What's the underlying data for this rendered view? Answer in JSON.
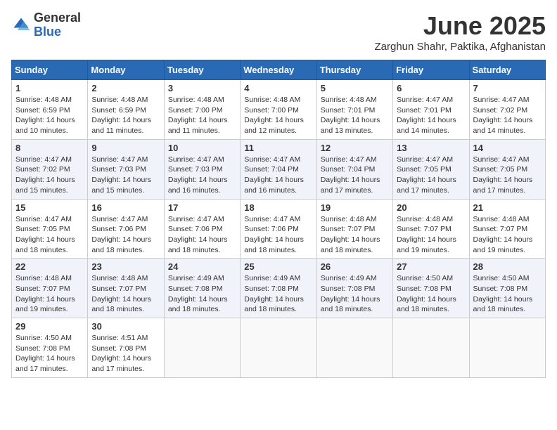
{
  "header": {
    "logo_general": "General",
    "logo_blue": "Blue",
    "month_title": "June 2025",
    "location": "Zarghun Shahr, Paktika, Afghanistan"
  },
  "days_of_week": [
    "Sunday",
    "Monday",
    "Tuesday",
    "Wednesday",
    "Thursday",
    "Friday",
    "Saturday"
  ],
  "weeks": [
    [
      {
        "day": "1",
        "sunrise": "4:48 AM",
        "sunset": "6:59 PM",
        "daylight": "14 hours and 10 minutes."
      },
      {
        "day": "2",
        "sunrise": "4:48 AM",
        "sunset": "6:59 PM",
        "daylight": "14 hours and 11 minutes."
      },
      {
        "day": "3",
        "sunrise": "4:48 AM",
        "sunset": "7:00 PM",
        "daylight": "14 hours and 11 minutes."
      },
      {
        "day": "4",
        "sunrise": "4:48 AM",
        "sunset": "7:00 PM",
        "daylight": "14 hours and 12 minutes."
      },
      {
        "day": "5",
        "sunrise": "4:48 AM",
        "sunset": "7:01 PM",
        "daylight": "14 hours and 13 minutes."
      },
      {
        "day": "6",
        "sunrise": "4:47 AM",
        "sunset": "7:01 PM",
        "daylight": "14 hours and 14 minutes."
      },
      {
        "day": "7",
        "sunrise": "4:47 AM",
        "sunset": "7:02 PM",
        "daylight": "14 hours and 14 minutes."
      }
    ],
    [
      {
        "day": "8",
        "sunrise": "4:47 AM",
        "sunset": "7:02 PM",
        "daylight": "14 hours and 15 minutes."
      },
      {
        "day": "9",
        "sunrise": "4:47 AM",
        "sunset": "7:03 PM",
        "daylight": "14 hours and 15 minutes."
      },
      {
        "day": "10",
        "sunrise": "4:47 AM",
        "sunset": "7:03 PM",
        "daylight": "14 hours and 16 minutes."
      },
      {
        "day": "11",
        "sunrise": "4:47 AM",
        "sunset": "7:04 PM",
        "daylight": "14 hours and 16 minutes."
      },
      {
        "day": "12",
        "sunrise": "4:47 AM",
        "sunset": "7:04 PM",
        "daylight": "14 hours and 17 minutes."
      },
      {
        "day": "13",
        "sunrise": "4:47 AM",
        "sunset": "7:05 PM",
        "daylight": "14 hours and 17 minutes."
      },
      {
        "day": "14",
        "sunrise": "4:47 AM",
        "sunset": "7:05 PM",
        "daylight": "14 hours and 17 minutes."
      }
    ],
    [
      {
        "day": "15",
        "sunrise": "4:47 AM",
        "sunset": "7:05 PM",
        "daylight": "14 hours and 18 minutes."
      },
      {
        "day": "16",
        "sunrise": "4:47 AM",
        "sunset": "7:06 PM",
        "daylight": "14 hours and 18 minutes."
      },
      {
        "day": "17",
        "sunrise": "4:47 AM",
        "sunset": "7:06 PM",
        "daylight": "14 hours and 18 minutes."
      },
      {
        "day": "18",
        "sunrise": "4:47 AM",
        "sunset": "7:06 PM",
        "daylight": "14 hours and 18 minutes."
      },
      {
        "day": "19",
        "sunrise": "4:48 AM",
        "sunset": "7:07 PM",
        "daylight": "14 hours and 18 minutes."
      },
      {
        "day": "20",
        "sunrise": "4:48 AM",
        "sunset": "7:07 PM",
        "daylight": "14 hours and 19 minutes."
      },
      {
        "day": "21",
        "sunrise": "4:48 AM",
        "sunset": "7:07 PM",
        "daylight": "14 hours and 19 minutes."
      }
    ],
    [
      {
        "day": "22",
        "sunrise": "4:48 AM",
        "sunset": "7:07 PM",
        "daylight": "14 hours and 19 minutes."
      },
      {
        "day": "23",
        "sunrise": "4:48 AM",
        "sunset": "7:07 PM",
        "daylight": "14 hours and 18 minutes."
      },
      {
        "day": "24",
        "sunrise": "4:49 AM",
        "sunset": "7:08 PM",
        "daylight": "14 hours and 18 minutes."
      },
      {
        "day": "25",
        "sunrise": "4:49 AM",
        "sunset": "7:08 PM",
        "daylight": "14 hours and 18 minutes."
      },
      {
        "day": "26",
        "sunrise": "4:49 AM",
        "sunset": "7:08 PM",
        "daylight": "14 hours and 18 minutes."
      },
      {
        "day": "27",
        "sunrise": "4:50 AM",
        "sunset": "7:08 PM",
        "daylight": "14 hours and 18 minutes."
      },
      {
        "day": "28",
        "sunrise": "4:50 AM",
        "sunset": "7:08 PM",
        "daylight": "14 hours and 18 minutes."
      }
    ],
    [
      {
        "day": "29",
        "sunrise": "4:50 AM",
        "sunset": "7:08 PM",
        "daylight": "14 hours and 17 minutes."
      },
      {
        "day": "30",
        "sunrise": "4:51 AM",
        "sunset": "7:08 PM",
        "daylight": "14 hours and 17 minutes."
      },
      null,
      null,
      null,
      null,
      null
    ]
  ]
}
